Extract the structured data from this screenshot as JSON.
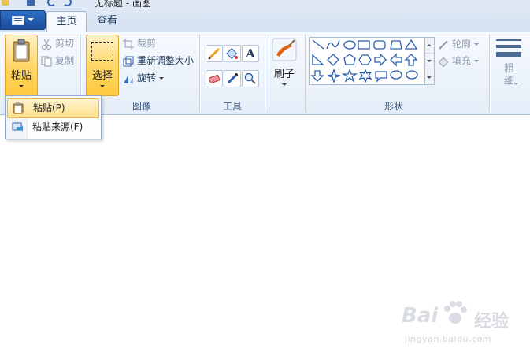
{
  "titlebar": {
    "title": "无标题 - 画图"
  },
  "tabs": [
    {
      "label": "主页"
    },
    {
      "label": "查看"
    }
  ],
  "clipboard": {
    "paste_label": "粘贴",
    "cut_label": "剪切",
    "copy_label": "复制"
  },
  "image": {
    "select_label": "选择",
    "crop_label": "裁剪",
    "resize_label": "重新调整大小",
    "rotate_label": "旋转",
    "group_label": "图像"
  },
  "tools": {
    "group_label": "工具"
  },
  "brushes": {
    "label": "刷子"
  },
  "shapes": {
    "outline_label": "轮廓",
    "fill_label": "填充",
    "group_label": "形状"
  },
  "size": {
    "label": "粗细"
  },
  "dropdown": {
    "items": [
      {
        "label": "粘贴(P)"
      },
      {
        "label": "粘贴来源(F)"
      }
    ]
  },
  "watermark": {
    "brand": "Bai",
    "brand_cn": "经验",
    "url": "jingyan.baidu.com"
  },
  "colors": {
    "accent_blue": "#1a4c9c",
    "highlight": "#ffd76a",
    "ribbon_bg": "#e4edf8"
  }
}
